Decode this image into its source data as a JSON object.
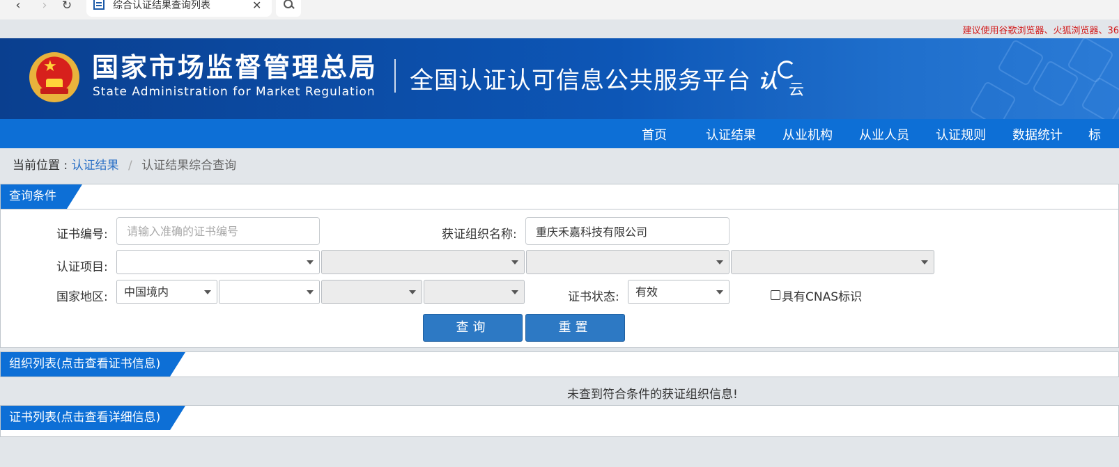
{
  "browser": {
    "tab_title": "综合认证结果查询列表",
    "back_icon": "back-arrow-icon",
    "forward_icon": "forward-arrow-icon",
    "reload_icon": "reload-icon"
  },
  "notice": "建议使用谷歌浏览器、火狐浏览器、36",
  "header": {
    "agency_cn": "国家市场监督管理总局",
    "agency_en": "State Administration  for  Market Regulation",
    "platform": "全国认证认可信息公共服务平台",
    "logo_text_1": "认",
    "logo_text_2": "云"
  },
  "nav": [
    "首页",
    "认证结果",
    "从业机构",
    "从业人员",
    "认证规则",
    "数据统计",
    "标"
  ],
  "breadcrumb": {
    "prefix": "当前位置 :",
    "link": "认证结果",
    "separator": "/",
    "current": "认证结果综合查询"
  },
  "query": {
    "title": "查询条件",
    "cert_no_label": "证书编号:",
    "cert_no_placeholder": "请输入准确的证书编号",
    "org_name_label": "获证组织名称:",
    "org_name_value": "重庆禾嘉科技有限公司",
    "project_label": "认证项目:",
    "region_label": "国家地区:",
    "region_value": "中国境内",
    "status_label": "证书状态:",
    "status_value": "有效",
    "cnas_label": "具有CNAS标识",
    "search_button": "查询",
    "reset_button": "重置"
  },
  "org_list": {
    "title": "组织列表(点击查看证书信息)",
    "empty_message": "未查到符合条件的获证组织信息!"
  },
  "cert_list": {
    "title": "证书列表(点击查看详细信息)"
  },
  "colors": {
    "header_blue": "#0d56b6",
    "nav_blue": "#0d6fd6",
    "button_blue": "#2d79c4",
    "notice_red": "#d21b1b"
  }
}
